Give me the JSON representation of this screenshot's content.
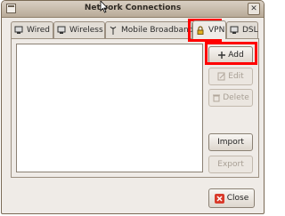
{
  "window": {
    "title": "Network Connections"
  },
  "tabs": [
    {
      "label": "Wired",
      "icon": "wired-icon"
    },
    {
      "label": "Wireless",
      "icon": "wireless-icon"
    },
    {
      "label": "Mobile Broadband",
      "icon": "antenna-icon"
    },
    {
      "label": "VPN",
      "icon": "lock-icon",
      "active": true
    },
    {
      "label": "DSL",
      "icon": "dsl-icon"
    }
  ],
  "buttons": {
    "add": "Add",
    "edit": "Edit",
    "delete": "Delete",
    "import": "Import",
    "export": "Export",
    "close": "Close"
  },
  "colors": {
    "highlight": "#ff0000",
    "close_icon": "#d93a2a"
  }
}
